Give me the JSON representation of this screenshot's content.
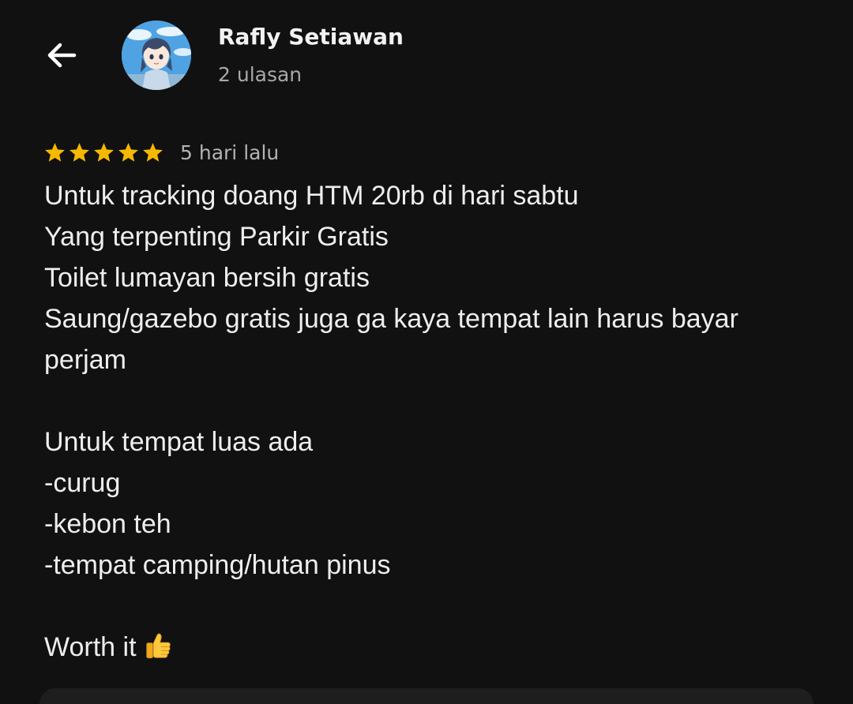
{
  "colors": {
    "background": "#111111",
    "star": "#f6b900",
    "text_primary": "#eeeeee",
    "text_secondary": "#a8a8a8"
  },
  "header": {
    "back_icon": "arrow-left-icon",
    "user_name": "Rafly Setiawan",
    "review_count": "2 ulasan"
  },
  "review": {
    "rating": 5,
    "rating_max": 5,
    "date": "5 hari lalu",
    "lines": [
      "Untuk tracking doang HTM 20rb di hari sabtu",
      "Yang terpenting Parkir Gratis",
      "Toilet lumayan bersih gratis",
      "Saung/gazebo gratis juga ga kaya tempat lain harus bayar",
      "perjam",
      "",
      "Untuk tempat luas ada",
      "-curug",
      "-kebon teh",
      "-tempat camping/hutan pinus",
      "",
      "Worth it"
    ],
    "closing_emoji": "thumbs-up-icon"
  }
}
